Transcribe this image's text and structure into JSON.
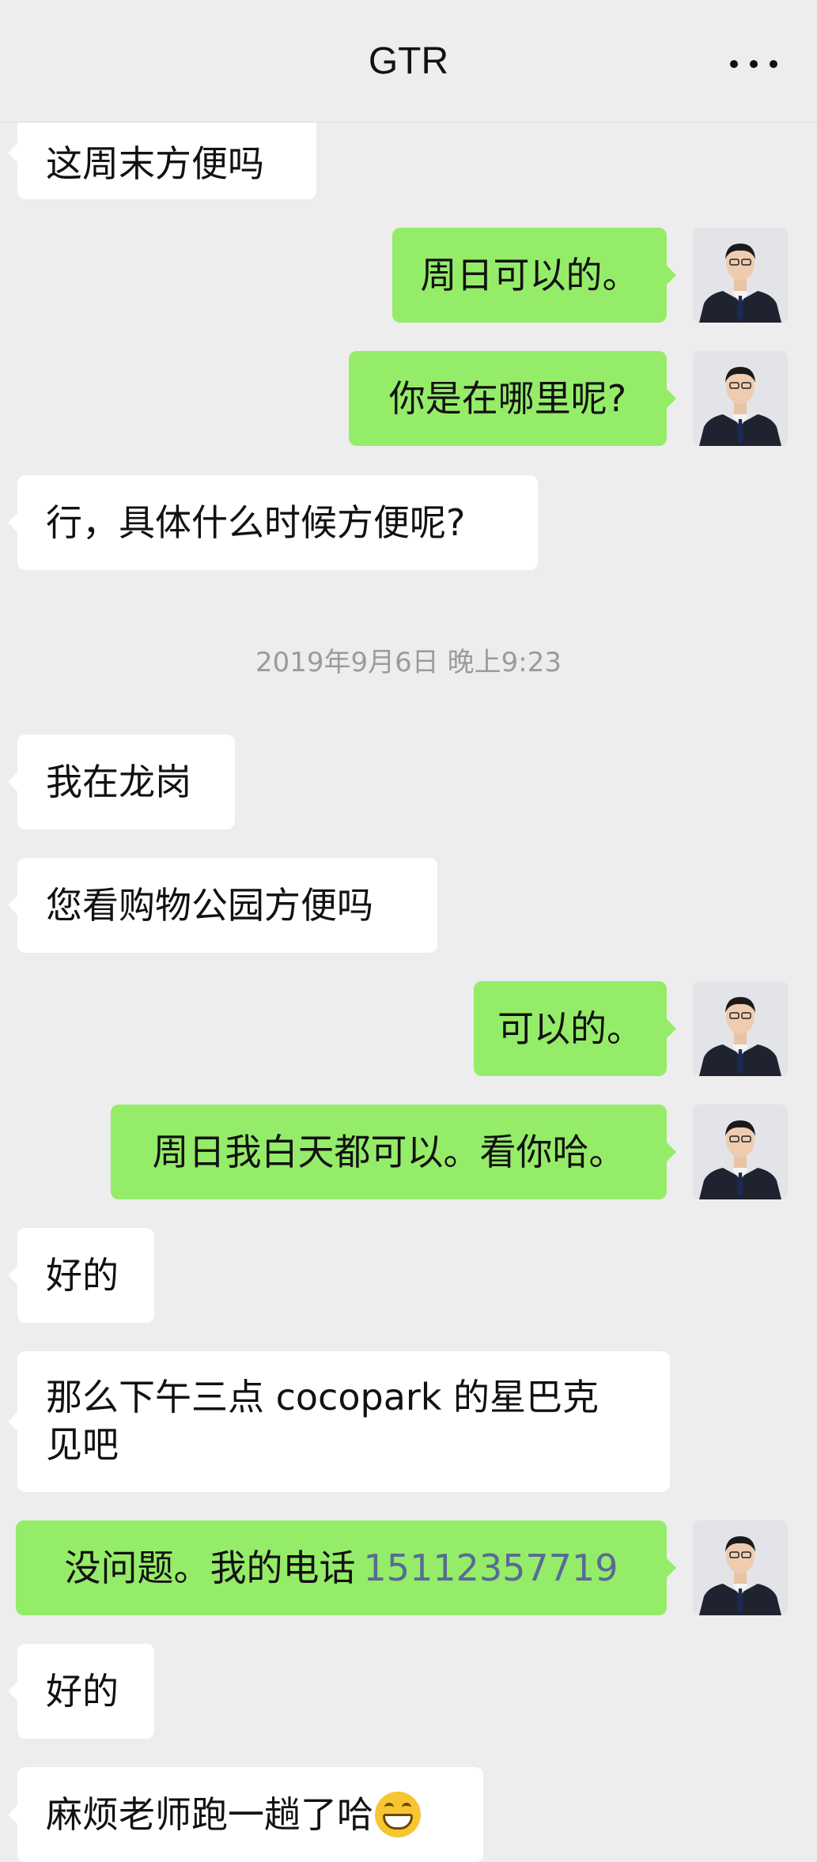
{
  "header": {
    "title": "GTR",
    "more_icon": "more-horizontal-icon"
  },
  "timestamp": "2019年9月6日 晚上9:23",
  "messages": [
    {
      "side": "left",
      "text": "这周末方便吗"
    },
    {
      "side": "right",
      "text": "周日可以的。"
    },
    {
      "side": "right",
      "text": "你是在哪里呢?"
    },
    {
      "side": "left",
      "text": "行，具体什么时候方便呢?"
    },
    {
      "side": "left",
      "text": "我在龙岗"
    },
    {
      "side": "left",
      "text": "您看购物公园方便吗"
    },
    {
      "side": "right",
      "text": "可以的。"
    },
    {
      "side": "right",
      "text": "周日我白天都可以。看你哈。"
    },
    {
      "side": "left",
      "text": "好的"
    },
    {
      "side": "left",
      "text": "那么下午三点 cocopark 的星巴克见吧"
    },
    {
      "side": "right",
      "text": "没问题。我的电话",
      "phone": "15112357719"
    },
    {
      "side": "left",
      "text": "好的"
    },
    {
      "side": "left",
      "text": "麻烦老师跑一趟了哈",
      "emoji": "grinning-face-emoji"
    }
  ],
  "colors": {
    "background": "#ededed",
    "incoming_bubble": "#ffffff",
    "outgoing_bubble": "#95ec69",
    "phone_link": "#576b95",
    "timestamp_text": "#9b9b9b"
  }
}
